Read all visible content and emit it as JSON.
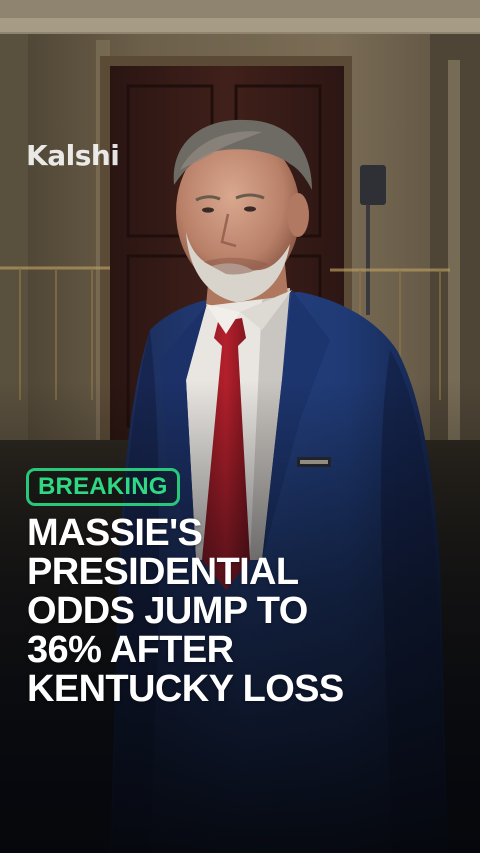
{
  "brand": {
    "watermark": "Kalshi"
  },
  "badge": {
    "label": "BREAKING",
    "color": "#28c77a"
  },
  "headline": {
    "lines": [
      "MASSIE'S",
      "PRESIDENTIAL",
      "ODDS JUMP TO",
      "36% AFTER",
      "KENTUCKY LOSS"
    ]
  },
  "photo": {
    "subject": "man in navy suit with red tie standing in hallway"
  }
}
